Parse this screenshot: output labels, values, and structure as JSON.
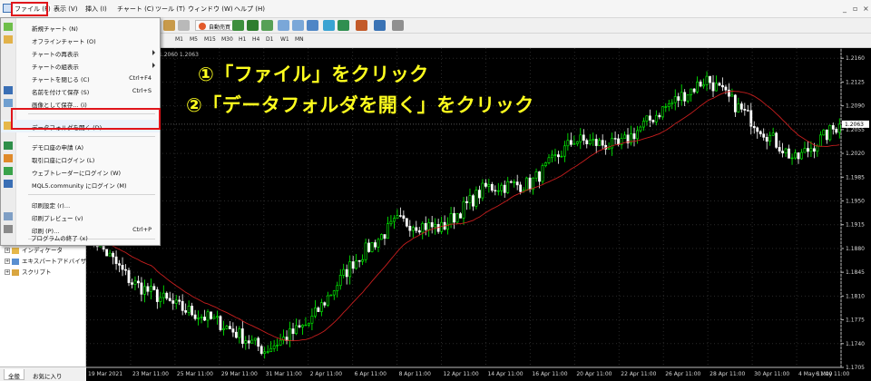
{
  "menubar": {
    "items": [
      "ファイル (F)",
      "表示 (V)",
      "挿入 (I)",
      "チャート (C)",
      "ツール (T)",
      "ウィンドウ (W)",
      "ヘルプ (H)"
    ],
    "window_controls": [
      "_",
      "▫",
      "×"
    ]
  },
  "toolbar": {
    "autotrade_label": "自動売買"
  },
  "timeframes": [
    "M1",
    "M5",
    "M15",
    "M30",
    "H1",
    "H4",
    "D1",
    "W1",
    "MN"
  ],
  "file_menu": {
    "items": [
      {
        "label": "新規チャート (N)",
        "shortcut": "",
        "submenu": false
      },
      {
        "label": "オフラインチャート (O)",
        "shortcut": "",
        "submenu": false
      },
      {
        "label": "チャートの再表示",
        "shortcut": "",
        "submenu": true
      },
      {
        "label": "チャートの組表示",
        "shortcut": "",
        "submenu": true
      },
      {
        "label": "チャートを閉じる (C)",
        "shortcut": "Ctrl+F4",
        "submenu": false
      },
      {
        "label": "名前を付けて保存 (S)",
        "shortcut": "Ctrl+S",
        "submenu": false
      },
      {
        "label": "画像として保存… (i)",
        "shortcut": "",
        "submenu": false
      },
      {
        "label": "データフォルダを開く (D)",
        "shortcut": "",
        "submenu": false
      },
      {
        "label": "デモ口座の申請 (A)",
        "shortcut": "",
        "submenu": false
      },
      {
        "label": "取引口座にログイン (L)",
        "shortcut": "",
        "submenu": false
      },
      {
        "label": "ウェブトレーダーにログイン (W)",
        "shortcut": "",
        "submenu": false
      },
      {
        "label": "MQL5.community にログイン (M)",
        "shortcut": "",
        "submenu": false
      },
      {
        "label": "印刷設定 (r)…",
        "shortcut": "",
        "submenu": false
      },
      {
        "label": "印刷プレビュー (v)",
        "shortcut": "",
        "submenu": false
      },
      {
        "label": "印刷 (P)…",
        "shortcut": "Ctrl+P",
        "submenu": false
      },
      {
        "label": "プログラムの終了 (x)",
        "shortcut": "",
        "submenu": false
      }
    ]
  },
  "navigator": {
    "tree": [
      "インディケータ",
      "エキスパートアドバイザ",
      "スクリプト"
    ],
    "tabs": [
      "全般",
      "お気に入り"
    ]
  },
  "annotations": {
    "step1": "①「ファイル」をクリック",
    "step2": "②「データフォルダを開く」をクリック"
  },
  "colors": {
    "highlight": "#e0151b",
    "annotation": "#ffff1e",
    "chart_bg": "#000000",
    "bull_candle": "#00ff00",
    "bear_candle": "#ffffff",
    "moving_average": "#c81e1e"
  },
  "chart": {
    "ohlc_text": "1.2060 1.2063",
    "current_price": "1.2063",
    "price_ticks": [
      "1.2160",
      "1.2125",
      "1.2090",
      "1.2055",
      "1.2020",
      "1.1985",
      "1.1950",
      "1.1915",
      "1.1880",
      "1.1845",
      "1.1810",
      "1.1775",
      "1.1740",
      "1.1705"
    ],
    "time_ticks": [
      "19 Mar 2021",
      "23 Mar 11:00",
      "25 Mar 11:00",
      "29 Mar 11:00",
      "31 Mar 11:00",
      "2 Apr 11:00",
      "6 Apr 11:00",
      "8 Apr 11:00",
      "12 Apr 11:00",
      "14 Apr 11:00",
      "16 Apr 11:00",
      "20 Apr 11:00",
      "22 Apr 11:00",
      "26 Apr 11:00",
      "28 Apr 11:00",
      "30 Apr 11:00",
      "4 May 11:00",
      "6 May 11:00"
    ]
  },
  "chart_data": {
    "type": "candlestick",
    "price_range": [
      1.1705,
      1.2175
    ],
    "anchors": [
      {
        "time": "19 Mar 2021",
        "price": 1.1905
      },
      {
        "time": "23 Mar 11:00",
        "price": 1.183
      },
      {
        "time": "25 Mar 11:00",
        "price": 1.1795
      },
      {
        "time": "29 Mar 11:00",
        "price": 1.177
      },
      {
        "time": "31 Mar 11:00",
        "price": 1.173
      },
      {
        "time": "2 Apr 11:00",
        "price": 1.177
      },
      {
        "time": "6 Apr 11:00",
        "price": 1.186
      },
      {
        "time": "8 Apr 11:00",
        "price": 1.192
      },
      {
        "time": "12 Apr 11:00",
        "price": 1.191
      },
      {
        "time": "14 Apr 11:00",
        "price": 1.197
      },
      {
        "time": "16 Apr 11:00",
        "price": 1.1975
      },
      {
        "time": "20 Apr 11:00",
        "price": 1.204
      },
      {
        "time": "22 Apr 11:00",
        "price": 1.203
      },
      {
        "time": "26 Apr 11:00",
        "price": 1.2085
      },
      {
        "time": "28 Apr 11:00",
        "price": 1.213
      },
      {
        "time": "30 Apr 11:00",
        "price": 1.207
      },
      {
        "time": "4 May 11:00",
        "price": 1.201
      },
      {
        "time": "6 May 11:00",
        "price": 1.2063
      }
    ]
  }
}
